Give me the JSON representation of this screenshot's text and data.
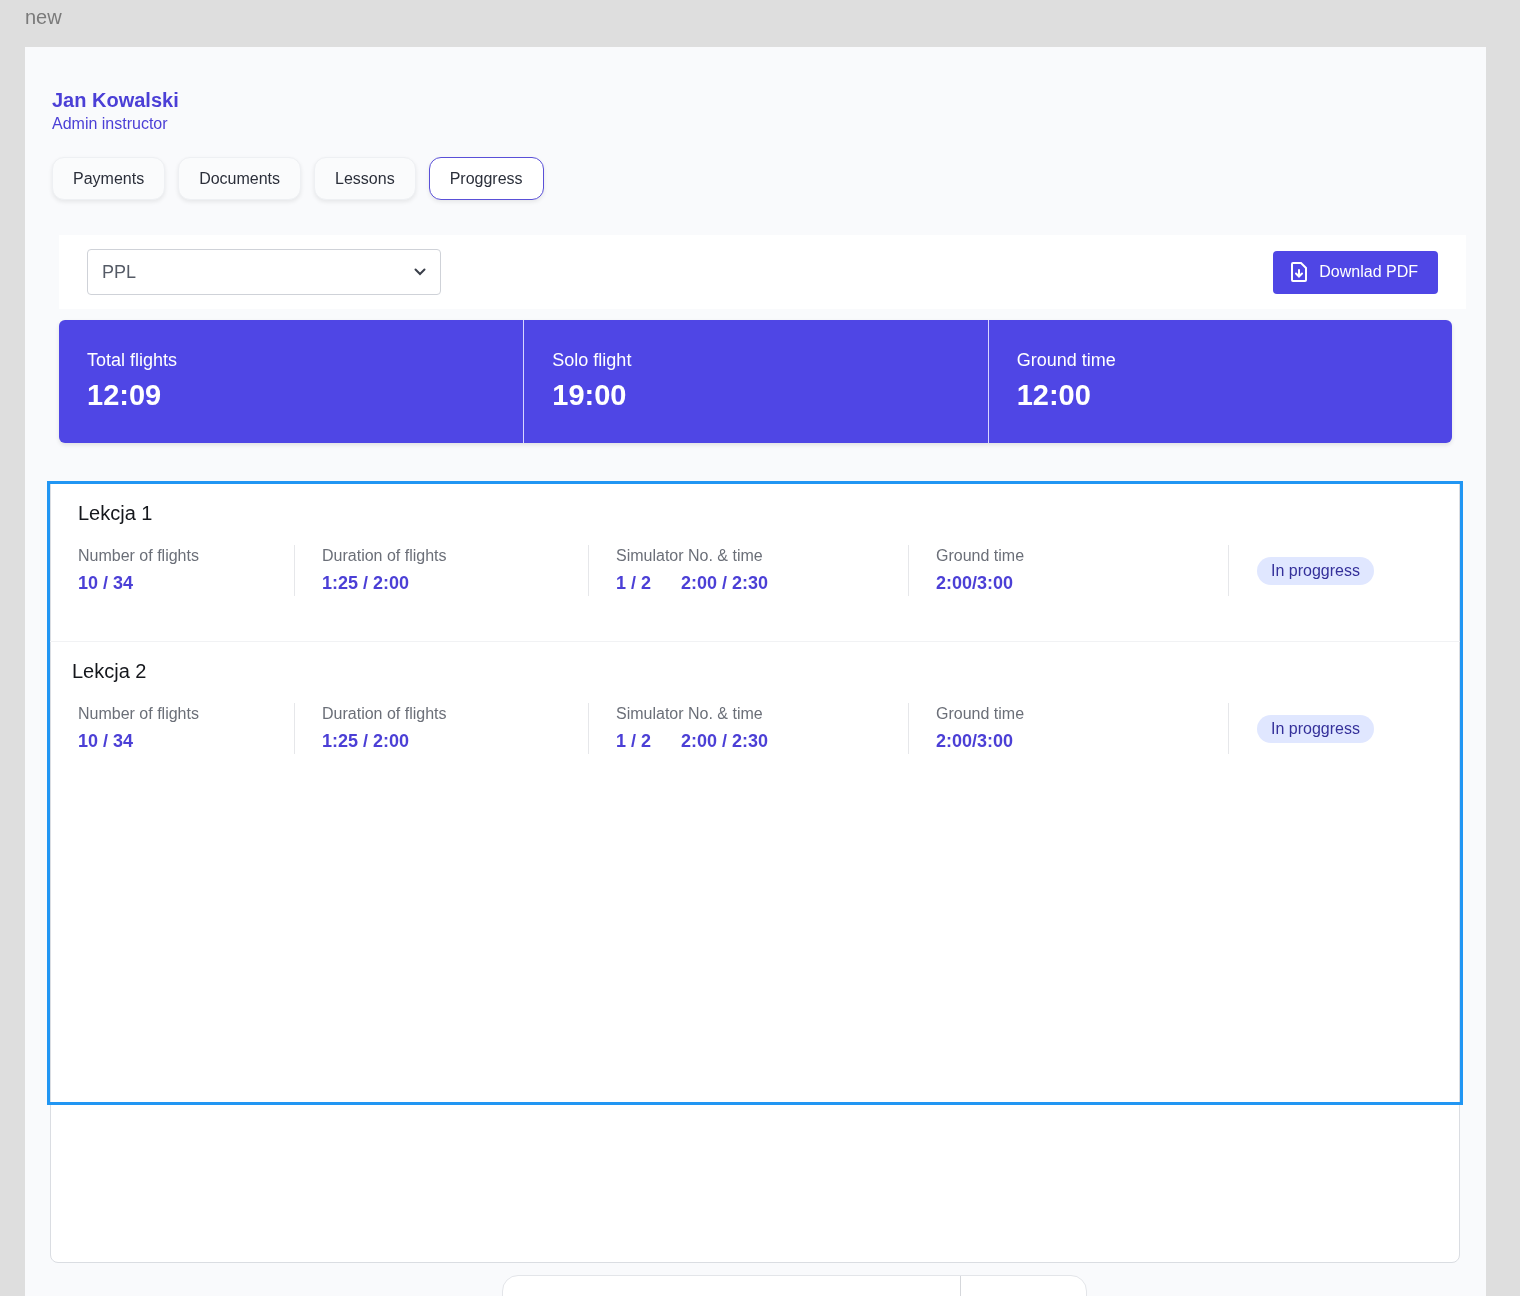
{
  "canvas_label": "new",
  "user": {
    "name": "Jan Kowalski",
    "role": "Admin instructor"
  },
  "tabs": [
    {
      "label": "Payments",
      "selected": false
    },
    {
      "label": "Documents",
      "selected": false
    },
    {
      "label": "Lessons",
      "selected": false
    },
    {
      "label": "Proggress",
      "selected": true
    }
  ],
  "course_select": {
    "value": "PPL"
  },
  "download_button": {
    "label": "Downlad PDF"
  },
  "stats": [
    {
      "label": "Total flights",
      "value": "12:09"
    },
    {
      "label": "Solo flight",
      "value": "19:00"
    },
    {
      "label": "Ground time",
      "value": "12:00"
    }
  ],
  "lessons": [
    {
      "title": "Lekcja 1",
      "status": "In proggress",
      "metrics": [
        {
          "label": "Number of flights",
          "values": [
            "10 / 34"
          ]
        },
        {
          "label": "Duration of flights",
          "values": [
            "1:25 / 2:00"
          ]
        },
        {
          "label": "Simulator No. & time",
          "values": [
            "1 / 2",
            "2:00 / 2:30"
          ]
        },
        {
          "label": "Ground time",
          "values": [
            "2:00/3:00"
          ]
        }
      ]
    },
    {
      "title": "Lekcja 2",
      "status": "In proggress",
      "metrics": [
        {
          "label": "Number of flights",
          "values": [
            "10 / 34"
          ]
        },
        {
          "label": "Duration of flights",
          "values": [
            "1:25 / 2:00"
          ]
        },
        {
          "label": "Simulator No. & time",
          "values": [
            "1 / 2",
            "2:00 / 2:30"
          ]
        },
        {
          "label": "Ground time",
          "values": [
            "2:00/3:00"
          ]
        }
      ]
    }
  ]
}
